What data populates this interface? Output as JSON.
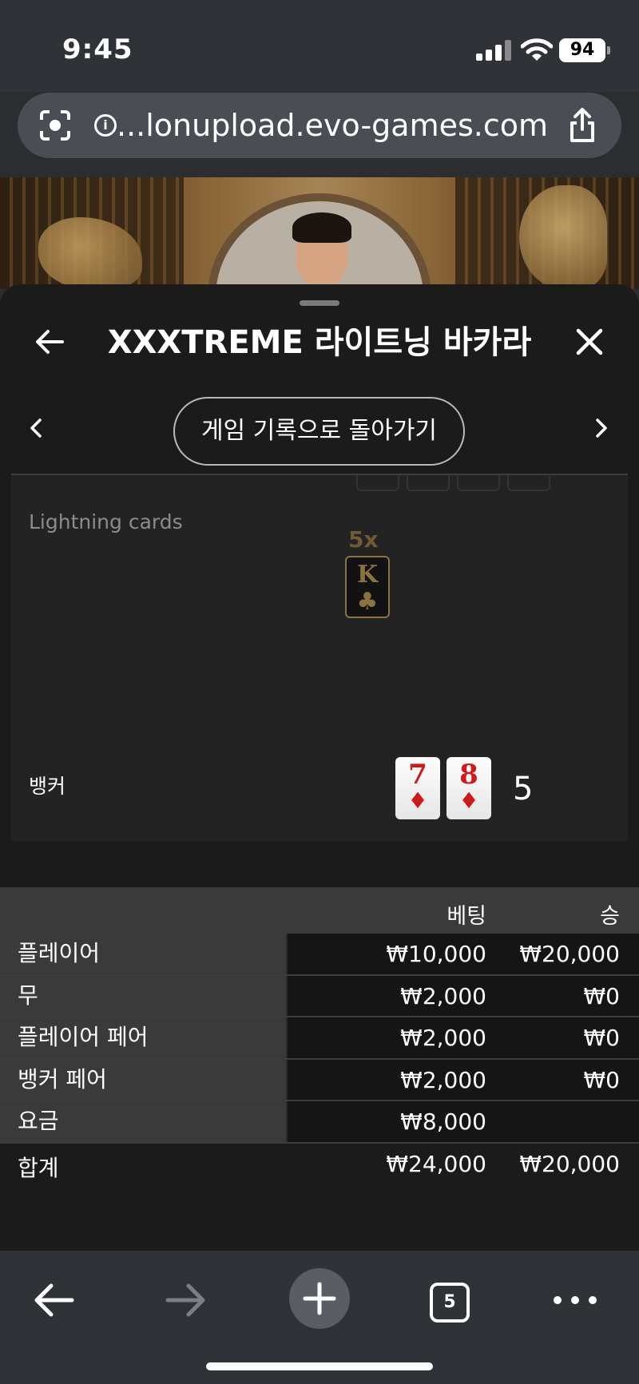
{
  "status": {
    "time": "9:45",
    "battery": "94"
  },
  "browser": {
    "url": "...lonupload.evo-games.com",
    "tab_count": "5"
  },
  "sheet": {
    "title": "XXXTREME 라이트닝 바카라",
    "history_button": "게임 기록으로 돌아가기"
  },
  "cards": {
    "lightning_label": "Lightning cards",
    "lightning_card": {
      "multiplier": "5x",
      "rank": "K",
      "suit": "♣"
    },
    "banker_label": "뱅커",
    "banker_cards": [
      {
        "rank": "7",
        "suit": "♦"
      },
      {
        "rank": "8",
        "suit": "♦"
      }
    ],
    "banker_score": "5"
  },
  "bets": {
    "header": {
      "bet": "베팅",
      "win": "승"
    },
    "rows": [
      {
        "label": "플레이어",
        "bet": "₩10,000",
        "win": "₩20,000"
      },
      {
        "label": "무",
        "bet": "₩2,000",
        "win": "₩0"
      },
      {
        "label": "플레이어 페어",
        "bet": "₩2,000",
        "win": "₩0"
      },
      {
        "label": "뱅커 페어",
        "bet": "₩2,000",
        "win": "₩0"
      },
      {
        "label": "요금",
        "bet": "₩8,000",
        "win": ""
      }
    ],
    "total": {
      "label": "합계",
      "bet": "₩24,000",
      "win": "₩20,000"
    }
  }
}
